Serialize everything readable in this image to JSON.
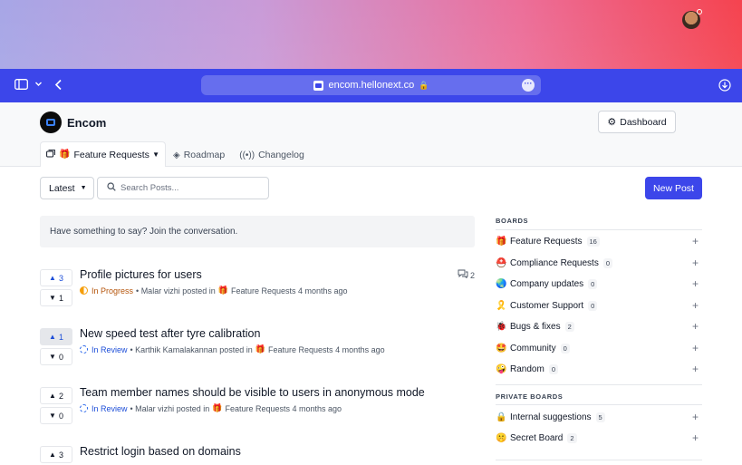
{
  "browser": {
    "url": "encom.hellonext.co",
    "icons": [
      "sidebar-icon",
      "chevron-down-icon",
      "back-icon",
      "lock-icon",
      "more-icon",
      "download-icon"
    ]
  },
  "header": {
    "brand": "Encom",
    "dashboard_label": "Dashboard",
    "tabs": [
      {
        "label": "Feature Requests",
        "icon": "gift-icon"
      },
      {
        "label": "Roadmap",
        "icon": "diamond-icon"
      },
      {
        "label": "Changelog",
        "icon": "broadcast-icon"
      }
    ]
  },
  "toolbar": {
    "sort_label": "Latest",
    "search_placeholder": "Search Posts...",
    "new_post_label": "New Post"
  },
  "composer": {
    "prompt": "Have something to say? Join the conversation."
  },
  "posts": [
    {
      "title": "Profile pictures for users",
      "upvotes": "3",
      "downvotes": "1",
      "status": "In Progress",
      "author": "Malar vizhi",
      "posted_in": "posted in",
      "board": "Feature Requests",
      "time": "4 months ago",
      "comments": "2"
    },
    {
      "title": "New speed test after tyre calibration",
      "upvotes": "1",
      "downvotes": "0",
      "status": "In Review",
      "author": "Karthik Kamalakannan",
      "posted_in": "posted in",
      "board": "Feature Requests",
      "time": "4 months ago"
    },
    {
      "title": "Team member names should be visible to users in anonymous mode",
      "upvotes": "2",
      "downvotes": "0",
      "status": "In Review",
      "author": "Malar vizhi",
      "posted_in": "posted in",
      "board": "Feature Requests",
      "time": "4 months ago"
    },
    {
      "title": "Restrict login based on domains",
      "upvotes": "3"
    }
  ],
  "sidebar": {
    "boards_heading": "BOARDS",
    "boards": [
      {
        "emoji": "🎁",
        "name": "Feature Requests",
        "count": "16"
      },
      {
        "emoji": "⛑️",
        "name": "Compliance Requests",
        "count": "0"
      },
      {
        "emoji": "🌏",
        "name": "Company updates",
        "count": "0"
      },
      {
        "emoji": "🎗️",
        "name": "Customer Support",
        "count": "0"
      },
      {
        "emoji": "🐞",
        "name": "Bugs & fixes",
        "count": "2"
      },
      {
        "emoji": "🤩",
        "name": "Community",
        "count": "0"
      },
      {
        "emoji": "🤪",
        "name": "Random",
        "count": "0"
      }
    ],
    "private_heading": "PRIVATE BOARDS",
    "private_boards": [
      {
        "emoji": "🔒",
        "name": "Internal suggestions",
        "count": "5"
      },
      {
        "emoji": "🤫",
        "name": "Secret Board",
        "count": "2"
      }
    ]
  },
  "colors": {
    "accent": "#3c46ea",
    "in_progress": "#b45309",
    "in_review": "#1d4ed8"
  }
}
